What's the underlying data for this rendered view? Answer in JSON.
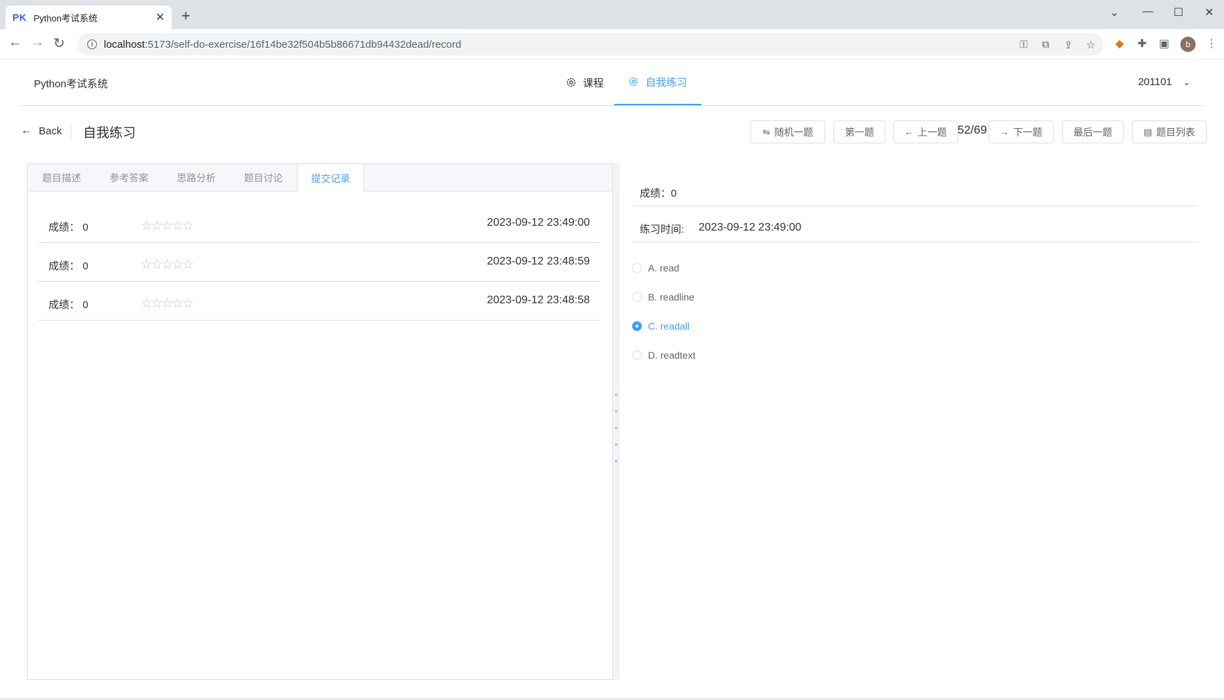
{
  "browser": {
    "tab_favicon": "PK",
    "tab_title": "Python考试系统",
    "tab_close": "✕",
    "new_tab": "+",
    "url_host": "localhost",
    "url_path": ":5173/self-do-exercise/16f14be32f504b5b86671db94432dead/record",
    "avatar_letter": "b"
  },
  "app": {
    "brand": "Python考试系统",
    "menu": [
      {
        "label": "课程",
        "icon": "gear-icon"
      },
      {
        "label": "自我练习",
        "icon": "gear-icon"
      }
    ],
    "user": "201101"
  },
  "page": {
    "back_label": "Back",
    "title": "自我练习",
    "buttons": {
      "random": "随机一题",
      "first": "第一题",
      "prev": "上一题",
      "counter": "52/69",
      "next": "下一题",
      "last": "最后一题",
      "list": "题目列表"
    }
  },
  "left": {
    "tabs": [
      "题目描述",
      "参考答案",
      "思路分析",
      "题目讨论",
      "提交记录"
    ],
    "active_tab": 4,
    "records": [
      {
        "score_label": "成绩：",
        "score": "0",
        "stars": "☆☆☆☆☆",
        "rating": 0,
        "time": "2023-09-12 23:49:00"
      },
      {
        "score_label": "成绩：",
        "score": "0",
        "stars": "☆☆☆☆☆",
        "rating": 0,
        "time": "2023-09-12 23:48:59"
      },
      {
        "score_label": "成绩：",
        "score": "0",
        "stars": "☆☆☆☆☆",
        "rating": 0,
        "time": "2023-09-12 23:48:58"
      }
    ]
  },
  "right": {
    "score_text": "成绩：0",
    "time_label": "练习时间:",
    "time_value": "2023-09-12 23:49:00",
    "options": [
      {
        "label": "A. read",
        "checked": false
      },
      {
        "label": "B. readline",
        "checked": false
      },
      {
        "label": "C. readall",
        "checked": true
      },
      {
        "label": "D. readtext",
        "checked": false
      }
    ]
  },
  "colors": {
    "accent": "#409eff",
    "text": "#303133",
    "border": "#dcdfe6"
  }
}
